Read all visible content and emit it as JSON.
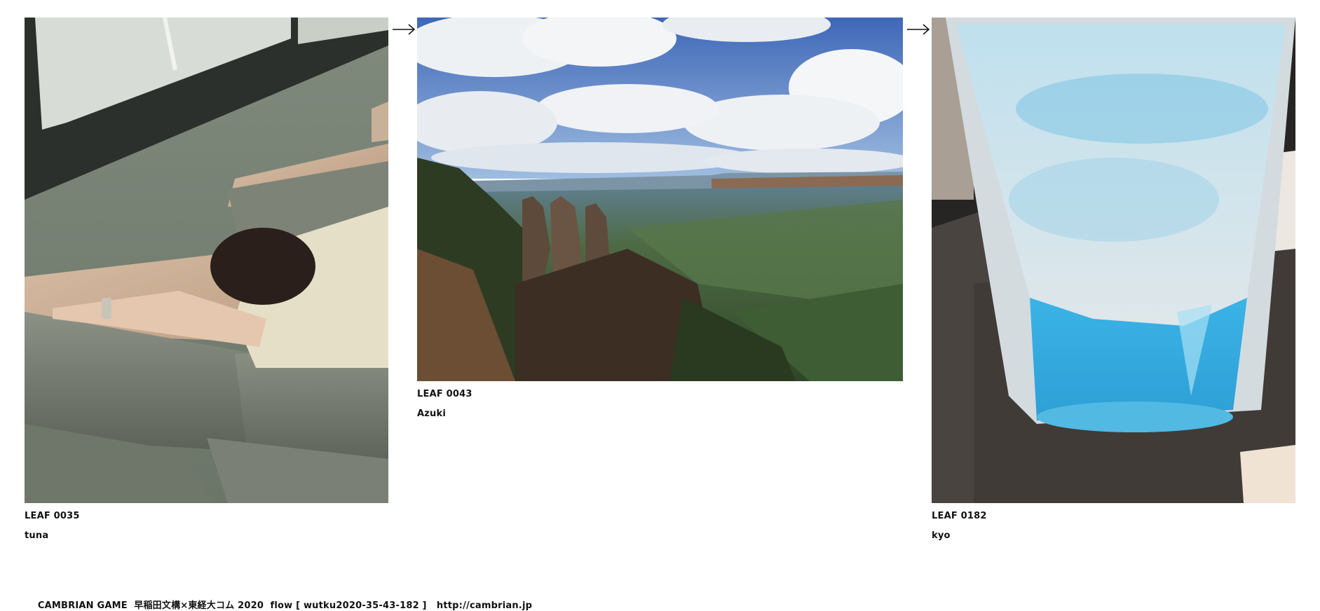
{
  "leaves": [
    {
      "id": "LEAF 0035",
      "author": "tuna"
    },
    {
      "id": "LEAF 0043",
      "author": "Azuki"
    },
    {
      "id": "LEAF 0182",
      "author": "kyo"
    }
  ],
  "arrows": [
    "arrow-right-icon",
    "arrow-right-icon"
  ],
  "footer": {
    "text": "CAMBRIAN GAME  早稲田文構×東経大コム 2020  flow [ wutku2020-35-43-182 ]",
    "link": "http://cambrian.jp"
  }
}
